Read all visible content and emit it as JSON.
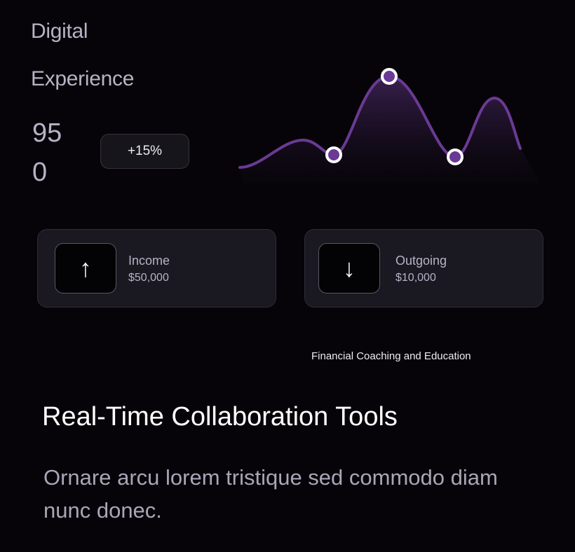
{
  "header": {
    "title_line1": "Digital",
    "title_line2": "Experience",
    "value_line1": "95",
    "value_line2": "0",
    "change_badge": "+15%"
  },
  "chart": {
    "line_color": "#6a3a94",
    "marker_fill": "#6a3a94",
    "marker_stroke": "#ffffff"
  },
  "cards": [
    {
      "label": "Income",
      "value": "$50,000",
      "icon": "arrow-up-icon",
      "glyph": "↑"
    },
    {
      "label": "Outgoing",
      "value": "$10,000",
      "icon": "arrow-down-icon",
      "glyph": "↓"
    }
  ],
  "caption": "Financial Coaching and Education",
  "section": {
    "headline": "Real-Time Collaboration Tools",
    "description": "Ornare arcu lorem tristique sed commodo diam nunc donec."
  }
}
